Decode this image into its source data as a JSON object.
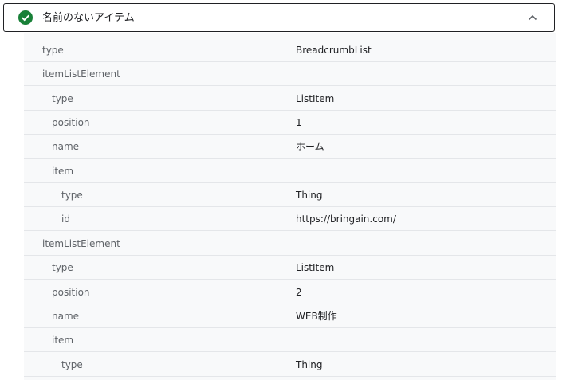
{
  "panel": {
    "title": "名前のないアイテム",
    "status_color": "#188038",
    "status_icon": "check-circle-icon",
    "toggle_icon": "chevron-up-icon"
  },
  "rows": [
    {
      "key": "type",
      "value": "BreadcrumbList"
    },
    {
      "key": "itemListElement",
      "value": ""
    },
    {
      "key": "type",
      "value": "ListItem"
    },
    {
      "key": "position",
      "value": "1"
    },
    {
      "key": "name",
      "value": "ホーム"
    },
    {
      "key": "item",
      "value": ""
    },
    {
      "key": "type",
      "value": "Thing"
    },
    {
      "key": "id",
      "value": "https://bringain.com/"
    },
    {
      "key": "itemListElement",
      "value": ""
    },
    {
      "key": "type",
      "value": "ListItem"
    },
    {
      "key": "position",
      "value": "2"
    },
    {
      "key": "name",
      "value": "WEB制作"
    },
    {
      "key": "item",
      "value": ""
    },
    {
      "key": "type",
      "value": "Thing"
    }
  ]
}
